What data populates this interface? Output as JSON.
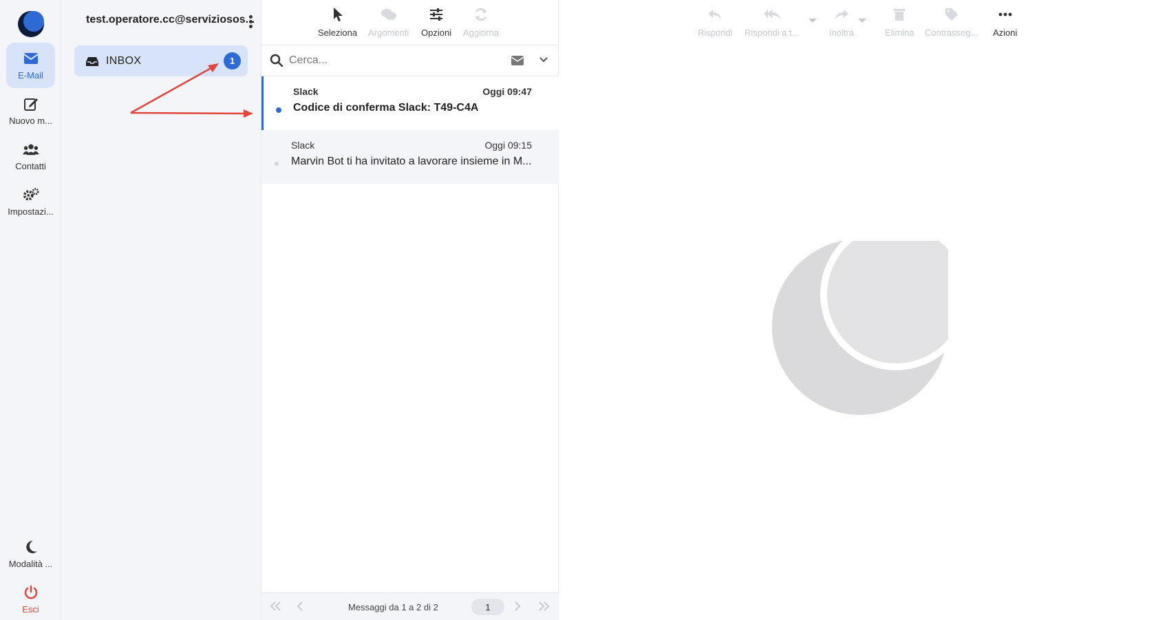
{
  "nav": {
    "items": [
      {
        "label": "E-Mail",
        "icon": "envelope-icon"
      },
      {
        "label": "Nuovo m...",
        "icon": "edit-icon"
      },
      {
        "label": "Contatti",
        "icon": "users-icon"
      },
      {
        "label": "Impostazi...",
        "icon": "gears-icon"
      }
    ],
    "bottom": [
      {
        "label": "Modalità ...",
        "icon": "moon-icon"
      },
      {
        "label": "Esci",
        "icon": "power-icon"
      }
    ]
  },
  "account": {
    "email": "test.operatore.cc@serviziosos..."
  },
  "folders": [
    {
      "name": "INBOX",
      "unread": "1"
    }
  ],
  "list_toolbar": {
    "select": "Seleziona",
    "threads": "Argomenti",
    "options": "Opzioni",
    "refresh": "Aggiorna"
  },
  "search": {
    "placeholder": "Cerca..."
  },
  "messages": [
    {
      "from": "Slack",
      "time": "Oggi 09:47",
      "subject": "Codice di conferma Slack: T49-C4A",
      "unread": true
    },
    {
      "from": "Slack",
      "time": "Oggi 09:15",
      "subject": "Marvin Bot ti ha invitato a lavorare insieme in M...",
      "unread": false
    }
  ],
  "pager": {
    "count": "Messaggi da 1 a 2 di 2",
    "page": "1"
  },
  "pane_toolbar": {
    "reply": "Rispondi",
    "reply_all": "Rispondi a t...",
    "forward": "Inoltra",
    "delete": "Elimina",
    "flag": "Contrasseg...",
    "actions": "Azioni"
  },
  "colors": {
    "accent": "#2e6ad6",
    "annotation": "#e2463b",
    "danger": "#e2463b"
  }
}
